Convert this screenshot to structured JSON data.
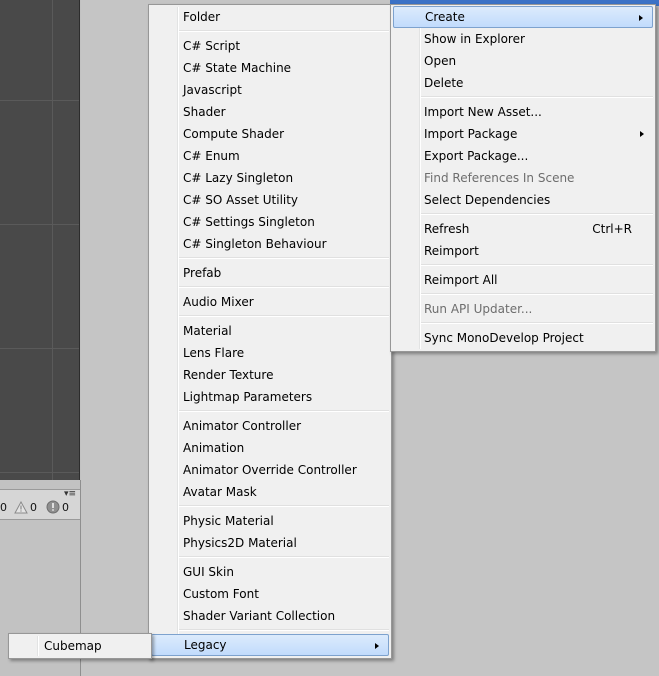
{
  "console": {
    "log_count": "0",
    "warning_count": "0",
    "error_count": "0",
    "menu_glyph": "▾≡"
  },
  "main_menu": {
    "items": [
      {
        "label": "Create",
        "submenu": true,
        "highlighted": true
      },
      {
        "label": "Show in Explorer"
      },
      {
        "label": "Open"
      },
      {
        "label": "Delete"
      },
      {
        "separator": true
      },
      {
        "label": "Import New Asset..."
      },
      {
        "label": "Import Package",
        "submenu": true
      },
      {
        "label": "Export Package..."
      },
      {
        "label": "Find References In Scene",
        "disabled": true
      },
      {
        "label": "Select Dependencies"
      },
      {
        "separator": true
      },
      {
        "label": "Refresh",
        "shortcut": "Ctrl+R"
      },
      {
        "label": "Reimport"
      },
      {
        "separator": true
      },
      {
        "label": "Reimport All"
      },
      {
        "separator": true
      },
      {
        "label": "Run API Updater...",
        "disabled": true
      },
      {
        "separator": true
      },
      {
        "label": "Sync MonoDevelop Project"
      }
    ]
  },
  "create_menu": {
    "items": [
      {
        "label": "Folder"
      },
      {
        "separator": true
      },
      {
        "label": "C# Script"
      },
      {
        "label": "C# State Machine"
      },
      {
        "label": "Javascript"
      },
      {
        "label": "Shader"
      },
      {
        "label": "Compute Shader"
      },
      {
        "label": "C# Enum"
      },
      {
        "label": "C# Lazy Singleton"
      },
      {
        "label": "C# SO Asset Utility"
      },
      {
        "label": "C# Settings Singleton"
      },
      {
        "label": "C# Singleton Behaviour"
      },
      {
        "separator": true
      },
      {
        "label": "Prefab"
      },
      {
        "separator": true
      },
      {
        "label": "Audio Mixer"
      },
      {
        "separator": true
      },
      {
        "label": "Material"
      },
      {
        "label": "Lens Flare"
      },
      {
        "label": "Render Texture"
      },
      {
        "label": "Lightmap Parameters"
      },
      {
        "separator": true
      },
      {
        "label": "Animator Controller"
      },
      {
        "label": "Animation"
      },
      {
        "label": "Animator Override Controller"
      },
      {
        "label": "Avatar Mask"
      },
      {
        "separator": true
      },
      {
        "label": "Physic Material"
      },
      {
        "label": "Physics2D Material"
      },
      {
        "separator": true
      },
      {
        "label": "GUI Skin"
      },
      {
        "label": "Custom Font"
      },
      {
        "label": "Shader Variant Collection"
      },
      {
        "separator": true
      },
      {
        "label": "Legacy",
        "submenu": true,
        "highlighted": true
      }
    ]
  },
  "legacy_menu": {
    "items": [
      {
        "label": "Cubemap"
      }
    ]
  },
  "colors": {
    "menu_background": "#f0f0f0",
    "highlight_top": "#dcebfc",
    "highlight_bottom": "#c1dbfc",
    "highlight_border": "#7da2ce",
    "disabled_text": "#6d6d6d",
    "scene_background": "#494949",
    "selection_blue": "#3b72c6"
  }
}
